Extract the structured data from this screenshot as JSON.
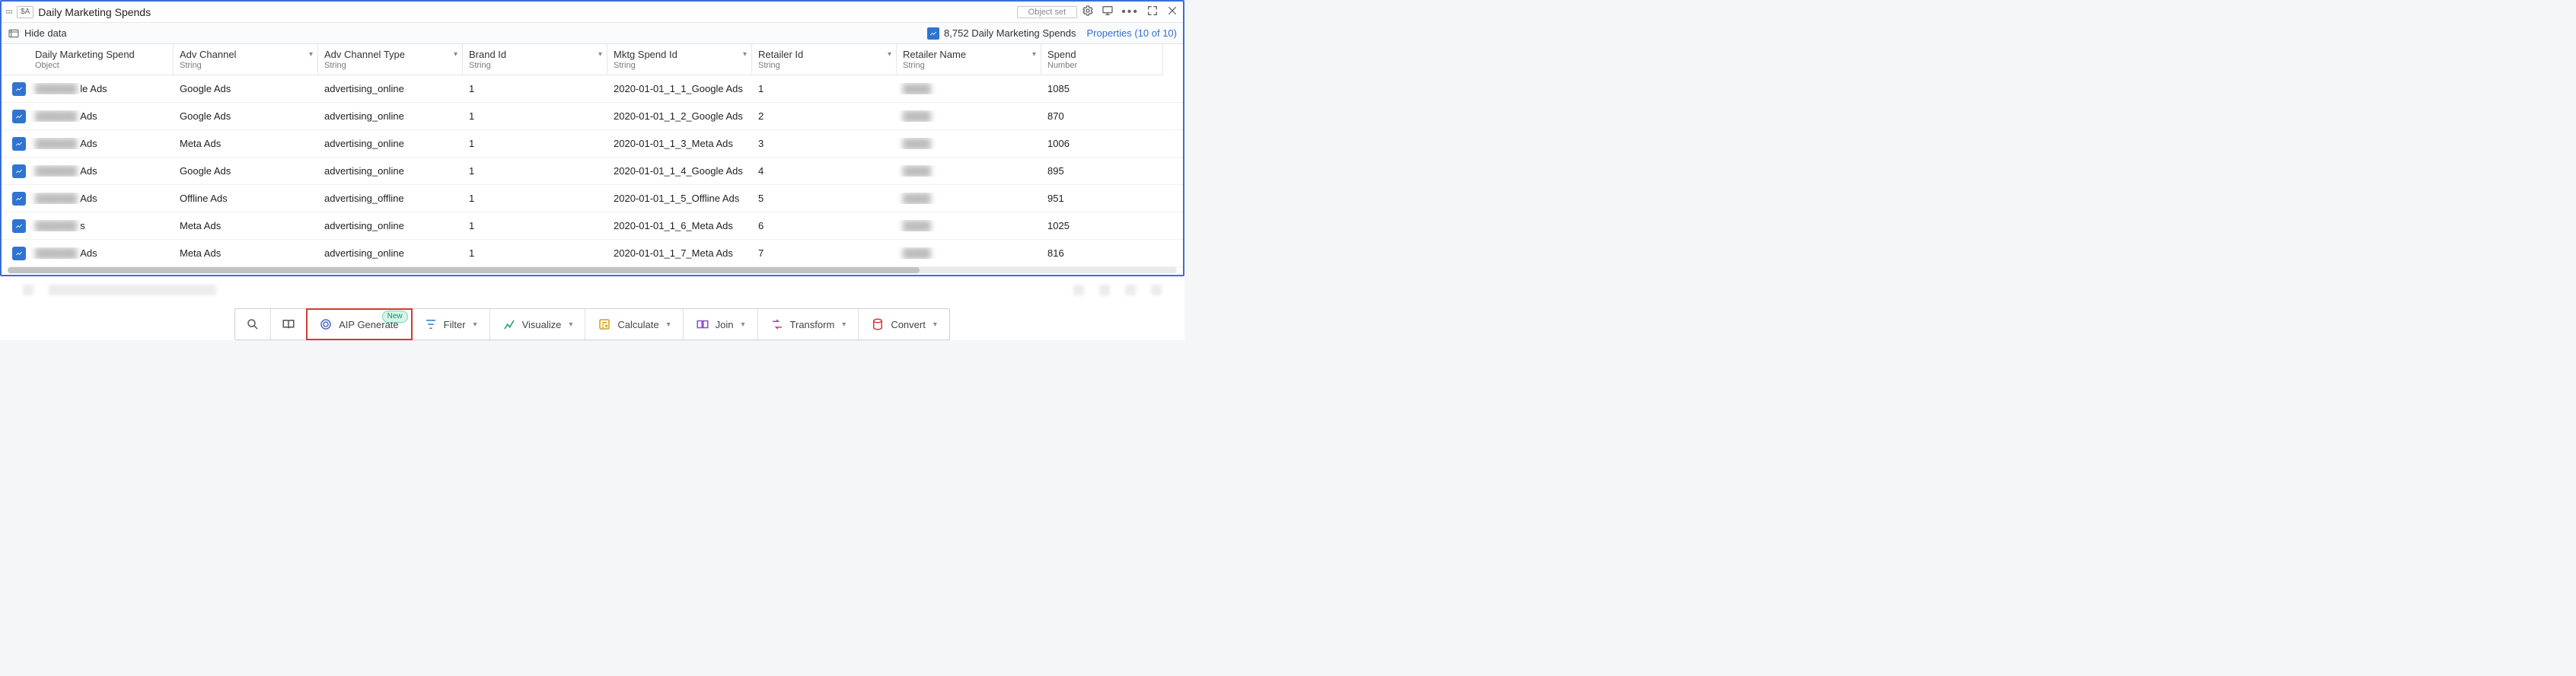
{
  "header": {
    "badge": "$A",
    "title": "Daily Marketing Spends",
    "object_set_label": "Object set"
  },
  "subbar": {
    "hide_data_label": "Hide data",
    "count_text": "8,752 Daily Marketing Spends",
    "properties_link": "Properties (10 of 10)"
  },
  "columns": [
    {
      "name": "Daily Marketing Spend",
      "type": "Object",
      "filterable": false
    },
    {
      "name": "Adv Channel",
      "type": "String",
      "filterable": true
    },
    {
      "name": "Adv Channel Type",
      "type": "String",
      "filterable": true
    },
    {
      "name": "Brand Id",
      "type": "String",
      "filterable": true
    },
    {
      "name": "Mktg Spend Id",
      "type": "String",
      "filterable": true
    },
    {
      "name": "Retailer Id",
      "type": "String",
      "filterable": true
    },
    {
      "name": "Retailer Name",
      "type": "String",
      "filterable": true
    },
    {
      "name": "Spend",
      "type": "Number",
      "filterable": false
    }
  ],
  "rows": [
    {
      "obj_suffix": "le Ads",
      "adv_channel": "Google Ads",
      "adv_channel_type": "advertising_online",
      "brand_id": "1",
      "mktg_spend_id": "2020-01-01_1_1_Google Ads",
      "retailer_id": "1",
      "retailer_name": "",
      "spend": "1085"
    },
    {
      "obj_suffix": "Ads",
      "adv_channel": "Google Ads",
      "adv_channel_type": "advertising_online",
      "brand_id": "1",
      "mktg_spend_id": "2020-01-01_1_2_Google Ads",
      "retailer_id": "2",
      "retailer_name": "",
      "spend": "870"
    },
    {
      "obj_suffix": "Ads",
      "adv_channel": "Meta Ads",
      "adv_channel_type": "advertising_online",
      "brand_id": "1",
      "mktg_spend_id": "2020-01-01_1_3_Meta Ads",
      "retailer_id": "3",
      "retailer_name": "",
      "spend": "1006"
    },
    {
      "obj_suffix": "Ads",
      "adv_channel": "Google Ads",
      "adv_channel_type": "advertising_online",
      "brand_id": "1",
      "mktg_spend_id": "2020-01-01_1_4_Google Ads",
      "retailer_id": "4",
      "retailer_name": "",
      "spend": "895"
    },
    {
      "obj_suffix": "Ads",
      "adv_channel": "Offline Ads",
      "adv_channel_type": "advertising_offline",
      "brand_id": "1",
      "mktg_spend_id": "2020-01-01_1_5_Offline Ads",
      "retailer_id": "5",
      "retailer_name": "",
      "spend": "951"
    },
    {
      "obj_suffix": "s",
      "adv_channel": "Meta Ads",
      "adv_channel_type": "advertising_online",
      "brand_id": "1",
      "mktg_spend_id": "2020-01-01_1_6_Meta Ads",
      "retailer_id": "6",
      "retailer_name": "",
      "spend": "1025"
    },
    {
      "obj_suffix": "Ads",
      "adv_channel": "Meta Ads",
      "adv_channel_type": "advertising_online",
      "brand_id": "1",
      "mktg_spend_id": "2020-01-01_1_7_Meta Ads",
      "retailer_id": "7",
      "retailer_name": "",
      "spend": "816"
    }
  ],
  "toolbar": {
    "aip_generate": "AIP Generate",
    "new_badge": "New",
    "filter": "Filter",
    "visualize": "Visualize",
    "calculate": "Calculate",
    "join": "Join",
    "transform": "Transform",
    "convert": "Convert"
  }
}
